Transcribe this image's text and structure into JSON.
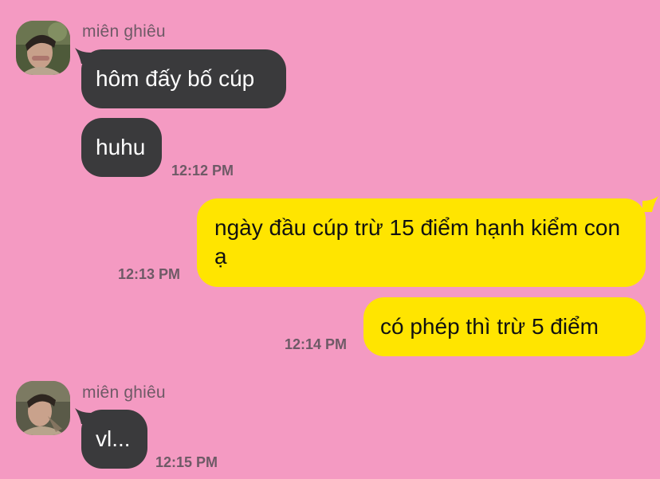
{
  "conversation": {
    "group1": {
      "sender": "miên ghiêu",
      "avatar": "profile-photo",
      "messages": [
        {
          "text": "hôm đấy bố cúp"
        },
        {
          "text": "huhu",
          "time": "12:12 PM"
        }
      ]
    },
    "outgoing": [
      {
        "text": "ngày đầu cúp trừ 15 điểm hạnh kiểm con ạ",
        "time": "12:13 PM"
      },
      {
        "text": "có phép thì trừ 5 điểm",
        "time": "12:14 PM"
      }
    ],
    "group2": {
      "sender": "miên ghiêu",
      "avatar": "profile-photo",
      "messages": [
        {
          "text": "vl...",
          "time": "12:15 PM"
        }
      ]
    }
  },
  "colors": {
    "background": "#F49AC2",
    "incoming_bubble": "#3A3A3C",
    "outgoing_bubble": "#FFE500",
    "meta_text": "#6E5A66"
  }
}
